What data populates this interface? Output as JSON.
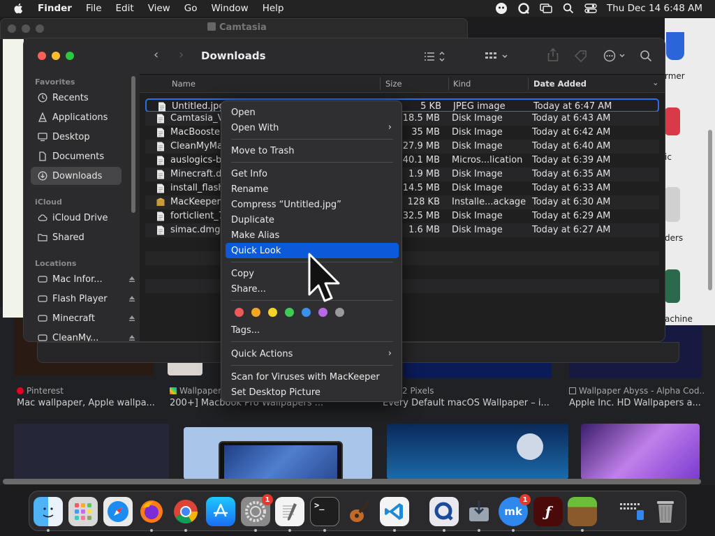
{
  "menubar": {
    "app": "Finder",
    "items": [
      "File",
      "Edit",
      "View",
      "Go",
      "Window",
      "Help"
    ],
    "clock": "Thu Dec 14  6:48 AM"
  },
  "camtasia": {
    "title": "Camtasia"
  },
  "right_labels": [
    "rmer",
    "ic",
    "ders",
    "achine"
  ],
  "browser": {
    "results": [
      {
        "source": "Pinterest",
        "title": "Mac wallpaper, Apple wallpa..."
      },
      {
        "source": "Wallpapers",
        "title": "200+] Macbook Pro Wallpapers ..."
      },
      {
        "source": "2 Pixels",
        "title": "Every Default macOS Wallpaper – i..."
      },
      {
        "source": "Wallpaper Abyss - Alpha Cod...",
        "title": "Apple Inc. HD Wallpapers a..."
      }
    ]
  },
  "finder": {
    "title": "Downloads",
    "sidebar": {
      "favorites_label": "Favorites",
      "favorites": [
        "Recents",
        "Applications",
        "Desktop",
        "Documents",
        "Downloads"
      ],
      "icloud_label": "iCloud",
      "icloud": [
        "iCloud Drive",
        "Shared"
      ],
      "locations_label": "Locations",
      "locations": [
        "Mac Infor...",
        "Flash Player",
        "Minecraft",
        "CleanMy..."
      ]
    },
    "columns": {
      "name": "Name",
      "size": "Size",
      "kind": "Kind",
      "date": "Date Added"
    },
    "files": [
      {
        "name": "Untitled.jpg",
        "size": "5 KB",
        "kind": "JPEG image",
        "date": "Today at 6:47 AM"
      },
      {
        "name": "Camtasia_V",
        "size": "418.5 MB",
        "kind": "Disk Image",
        "date": "Today at 6:43 AM"
      },
      {
        "name": "MacBooster",
        "size": "35 MB",
        "kind": "Disk Image",
        "date": "Today at 6:42 AM"
      },
      {
        "name": "CleanMyMa",
        "size": "127.9 MB",
        "kind": "Disk Image",
        "date": "Today at 6:40 AM"
      },
      {
        "name": "auslogics-b",
        "size": "40.1 MB",
        "kind": "Micros...lication",
        "date": "Today at 6:39 AM"
      },
      {
        "name": "Minecraft.d",
        "size": "1.9 MB",
        "kind": "Disk Image",
        "date": "Today at 6:35 AM"
      },
      {
        "name": "install_flash",
        "size": "14.5 MB",
        "kind": "Disk Image",
        "date": "Today at 6:33 AM"
      },
      {
        "name": "MacKeeper.",
        "size": "128 KB",
        "kind": "Installe...ackage",
        "date": "Today at 6:30 AM"
      },
      {
        "name": "forticlient_7",
        "size": "232.5 MB",
        "kind": "Disk Image",
        "date": "Today at 6:29 AM"
      },
      {
        "name": "simac.dmg",
        "size": "1.6 MB",
        "kind": "Disk Image",
        "date": "Today at 6:27 AM"
      }
    ]
  },
  "context_menu": {
    "open": "Open",
    "open_with": "Open With",
    "move_to_trash": "Move to Trash",
    "get_info": "Get Info",
    "rename": "Rename",
    "compress": "Compress “Untitled.jpg”",
    "duplicate": "Duplicate",
    "make_alias": "Make Alias",
    "quick_look": "Quick Look",
    "copy": "Copy",
    "share": "Share...",
    "tags": "Tags...",
    "quick_actions": "Quick Actions",
    "scan": "Scan for Viruses with MacKeeper",
    "set_desktop": "Set Desktop Picture",
    "tag_colors": [
      "#ee5a5a",
      "#f5a623",
      "#f5d327",
      "#3fc957",
      "#3a8fea",
      "#b86ae6",
      "#9a9a9a"
    ]
  },
  "dock": {
    "badges": {
      "settings": "1",
      "mackeeper": "1"
    }
  },
  "colors": {
    "accent": "#0b5ad9",
    "selection_border": "#2f6ee0"
  }
}
